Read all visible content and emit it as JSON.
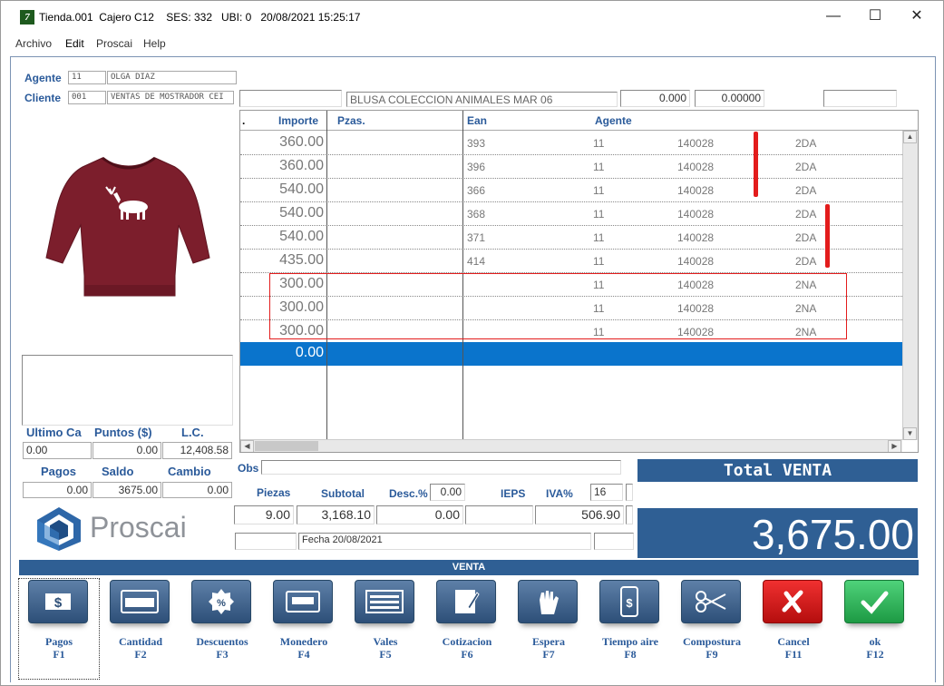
{
  "window": {
    "title": "Tienda.001  Cajero C12    SES: 332   UBI: 0   20/08/2021 15:25:17",
    "min": "—",
    "max": "☐",
    "close": "✕"
  },
  "menu": [
    "Archivo",
    "Edit",
    "Proscai",
    "Help"
  ],
  "agente": {
    "label": "Agente",
    "code": "11",
    "name": "OLGA DIAZ"
  },
  "cliente": {
    "label": "Cliente",
    "code": "001",
    "name": "VENTAS DE MOSTRADOR CEI"
  },
  "product_desc": "BLUSA COLECCION ANIMALES MAR 06",
  "top_fields": {
    "f1": "0.000",
    "f2": "0.00000"
  },
  "grid": {
    "headers": {
      "dot": ".",
      "importe": "Importe",
      "pzas": "Pzas.",
      "ean": "Ean",
      "agente": "Agente"
    },
    "rows": [
      {
        "importe": "360.00",
        "ean": "393",
        "agente": "11",
        "col5": "140028",
        "col6": "2DA"
      },
      {
        "importe": "360.00",
        "ean": "396",
        "agente": "11",
        "col5": "140028",
        "col6": "2DA"
      },
      {
        "importe": "540.00",
        "ean": "366",
        "agente": "11",
        "col5": "140028",
        "col6": "2DA"
      },
      {
        "importe": "540.00",
        "ean": "368",
        "agente": "11",
        "col5": "140028",
        "col6": "2DA"
      },
      {
        "importe": "540.00",
        "ean": "371",
        "agente": "11",
        "col5": "140028",
        "col6": "2DA"
      },
      {
        "importe": "435.00",
        "ean": "414",
        "agente": "11",
        "col5": "140028",
        "col6": "2DA"
      },
      {
        "importe": "300.00",
        "ean": "",
        "agente": "11",
        "col5": "140028",
        "col6": "2NA"
      },
      {
        "importe": "300.00",
        "ean": "",
        "agente": "11",
        "col5": "140028",
        "col6": "2NA"
      },
      {
        "importe": "300.00",
        "ean": "",
        "agente": "11",
        "col5": "140028",
        "col6": "2NA"
      }
    ],
    "selected_importe": "0.00"
  },
  "ultimo": {
    "label1": "Ultimo Ca",
    "label2": "Puntos ($)",
    "label3": "L.C.",
    "v1": "0.00",
    "v2": "0.00",
    "v3": "12,408.58"
  },
  "pagos": {
    "label1": "Pagos",
    "label2": "Saldo",
    "label3": "Cambio",
    "v1": "0.00",
    "v2": "3675.00",
    "v3": "0.00"
  },
  "logo_text": "Proscai",
  "obs_label": "Obs",
  "totals": {
    "piezas_label": "Piezas",
    "subtotal_label": "Subtotal",
    "desc_label": "Desc.%",
    "desc_pct": "0.00",
    "ieps_label": "IEPS",
    "iva_label": "IVA%",
    "iva_pct": "16",
    "piezas": "9.00",
    "subtotal": "3,168.10",
    "descuento": "0.00",
    "iva": "506.90",
    "fecha": "Fecha 20/08/2021"
  },
  "total_venta_label": "Total VENTA",
  "total_venta": "3,675.00",
  "venta_bar": "VENTA",
  "buttons": [
    {
      "label": "Pagos",
      "key": "F1"
    },
    {
      "label": "Cantidad",
      "key": "F2"
    },
    {
      "label": "Descuentos",
      "key": "F3"
    },
    {
      "label": "Monedero",
      "key": "F4"
    },
    {
      "label": "Vales",
      "key": "F5"
    },
    {
      "label": "Cotizacion",
      "key": "F6"
    },
    {
      "label": "Espera",
      "key": "F7"
    },
    {
      "label": "Tiempo aire",
      "key": "F8"
    },
    {
      "label": "Compostura",
      "key": "F9"
    },
    {
      "label": "Cancel",
      "key": "F11"
    },
    {
      "label": "ok",
      "key": "F12"
    }
  ],
  "icons": [
    "dollar-icon",
    "calculator-icon",
    "percent-icon",
    "card-icon",
    "voucher-icon",
    "quote-icon",
    "hand-icon",
    "phone-icon",
    "scissors-icon",
    "cancel-icon",
    "check-icon"
  ],
  "colors": {
    "accent": "#2f5f94",
    "selection": "#0a74cc",
    "annotation": "#e31c1c",
    "label": "#2a5a9a"
  }
}
